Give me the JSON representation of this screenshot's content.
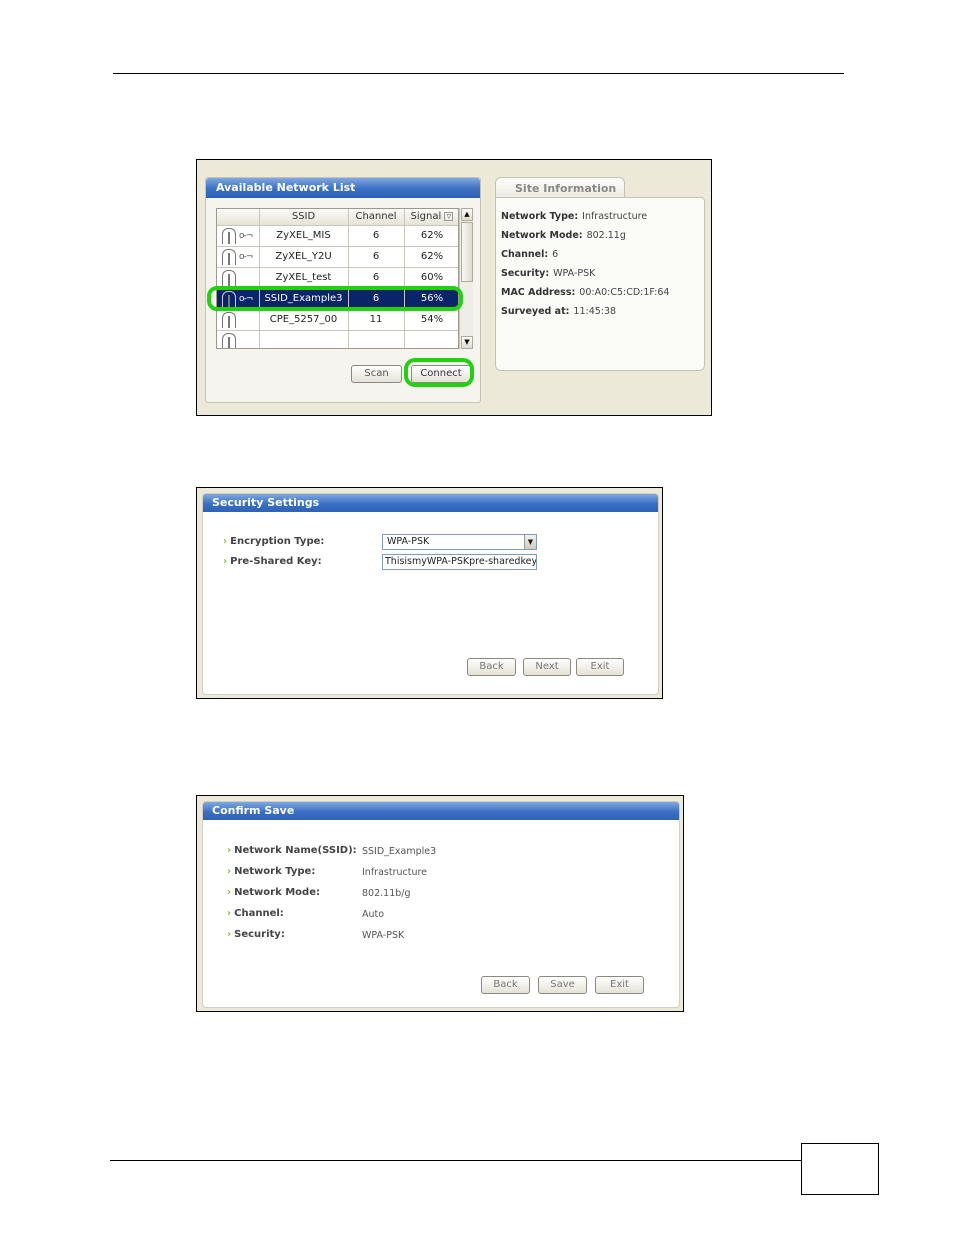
{
  "network_list": {
    "title": "Available Network List",
    "columns": [
      "SSID",
      "Channel",
      "Signal"
    ],
    "rows": [
      {
        "ssid": "ZyXEL_MIS",
        "channel": "6",
        "signal": "62%",
        "secured": true,
        "selected": false
      },
      {
        "ssid": "ZyXEL_Y2U",
        "channel": "6",
        "signal": "62%",
        "secured": true,
        "selected": false
      },
      {
        "ssid": "ZyXEL_test",
        "channel": "6",
        "signal": "60%",
        "secured": false,
        "selected": false
      },
      {
        "ssid": "SSID_Example3",
        "channel": "6",
        "signal": "56%",
        "secured": true,
        "selected": true
      },
      {
        "ssid": "CPE_5257_00",
        "channel": "11",
        "signal": "54%",
        "secured": false,
        "selected": false
      },
      {
        "ssid": "",
        "channel": "",
        "signal": "",
        "secured": false,
        "selected": false
      }
    ],
    "scan_label": "Scan",
    "connect_label": "Connect"
  },
  "site_info": {
    "tab_label": "Site Information",
    "fields": [
      {
        "label": "Network Type:",
        "value": "Infrastructure"
      },
      {
        "label": "Network Mode:",
        "value": "802.11g"
      },
      {
        "label": "Channel:",
        "value": "6"
      },
      {
        "label": "Security:",
        "value": "WPA-PSK"
      },
      {
        "label": "MAC Address:",
        "value": "00:A0:C5:CD:1F:64"
      },
      {
        "label": "Surveyed at:",
        "value": "11:45:38"
      }
    ]
  },
  "security_settings": {
    "title": "Security Settings",
    "encryption_label": "Encryption Type:",
    "encryption_value": "WPA-PSK",
    "psk_label": "Pre-Shared Key:",
    "psk_value": "ThisismyWPA-PSKpre-sharedkey",
    "back_label": "Back",
    "next_label": "Next",
    "exit_label": "Exit"
  },
  "confirm_save": {
    "title": "Confirm Save",
    "fields": [
      {
        "label": "Network Name(SSID):",
        "value": "SSID_Example3"
      },
      {
        "label": "Network Type:",
        "value": "Infrastructure"
      },
      {
        "label": "Network Mode:",
        "value": "802.11b/g"
      },
      {
        "label": "Channel:",
        "value": "Auto"
      },
      {
        "label": "Security:",
        "value": "WPA-PSK"
      }
    ],
    "back_label": "Back",
    "save_label": "Save",
    "exit_label": "Exit"
  },
  "colors": {
    "highlight": "#22d20f",
    "title_bar": "#3a6fc4",
    "selected_row": "#0a246a",
    "arrow": "#86c12c"
  },
  "icons": [
    "signal-strength-icon",
    "key-icon",
    "arrow-right-icon",
    "dropdown-arrow-icon"
  ]
}
